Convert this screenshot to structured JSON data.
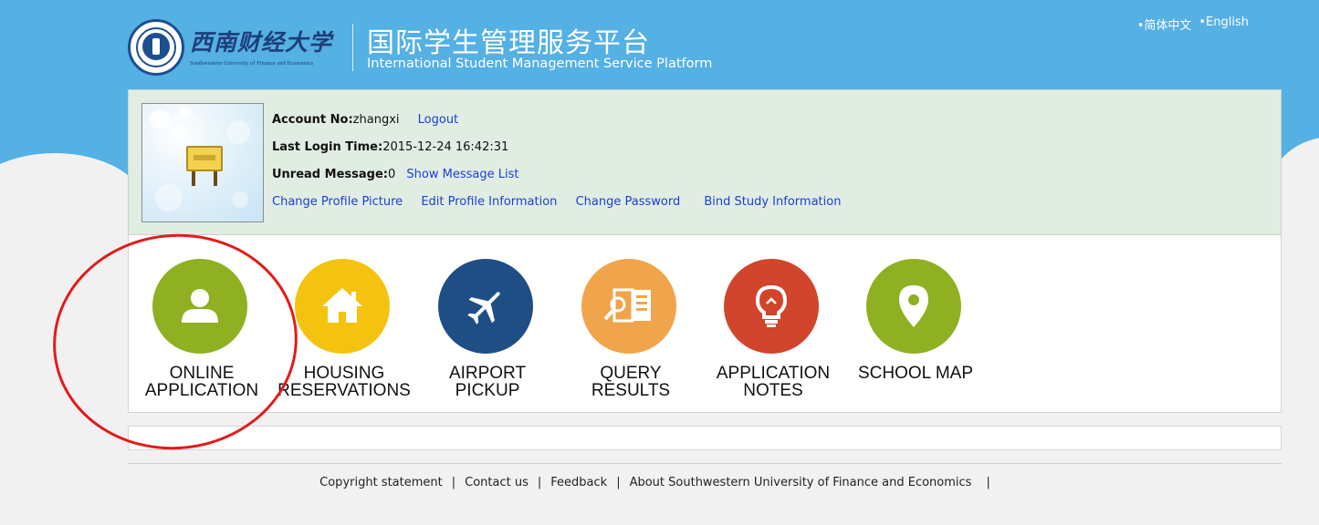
{
  "header": {
    "university_cn": "西南财经大学",
    "university_en": "Southwestern University of Finance and Economics",
    "platform_cn": "国际学生管理服务平台",
    "platform_en": "International Student Management Service Platform",
    "languages": [
      "•简体中文",
      "•English"
    ]
  },
  "profile": {
    "account_label": "Account No:",
    "account_value": "zhangxi",
    "logout": "Logout",
    "last_login_label": "Last Login Time:",
    "last_login_value": "2015-12-24 16:42:31",
    "unread_label": "Unread Message:",
    "unread_value": "0",
    "show_messages": "Show Message List",
    "links": [
      "Change Profile Picture",
      "Edit Profile Information",
      "Change Password",
      "Bind Study Information"
    ]
  },
  "tiles": [
    {
      "line1": "ONLINE",
      "line2": "APPLICATION",
      "color": "#8eb021",
      "icon": "user-icon"
    },
    {
      "line1": "HOUSING",
      "line2": "RESERVATIONS",
      "color": "#f3c310",
      "icon": "house-icon"
    },
    {
      "line1": "AIRPORT",
      "line2": "PICKUP",
      "color": "#1f4e85",
      "icon": "airplane-icon"
    },
    {
      "line1": "QUERY",
      "line2": "RESULTS",
      "color": "#f0a44b",
      "icon": "document-search-icon"
    },
    {
      "line1": "APPLICATION",
      "line2": "NOTES",
      "color": "#d0452b",
      "icon": "lightbulb-icon"
    },
    {
      "line1": "SCHOOL MAP",
      "line2": "",
      "color": "#8eb021",
      "icon": "map-pin-icon"
    }
  ],
  "footer": {
    "links": [
      "Copyright statement",
      "Contact us",
      "Feedback",
      "About Southwestern University of Finance and Economics"
    ],
    "separator": "|"
  },
  "colors": {
    "header_blue": "#55b0e3",
    "annotation_red": "#e21b1b",
    "link_blue": "#1a3fd6"
  }
}
